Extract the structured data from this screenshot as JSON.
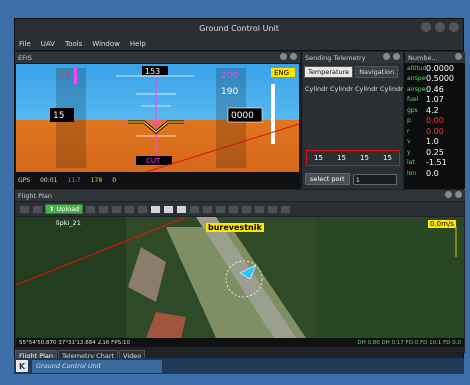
{
  "window": {
    "title": "Ground Control Unit"
  },
  "menu": [
    "File",
    "UAV",
    "Tools",
    "Window",
    "Help"
  ],
  "efis": {
    "panel_title": "EFIS",
    "speed": "23",
    "speed_lower": "15",
    "altitude": "200",
    "altitude_lower": "190",
    "heading": "153",
    "altitude_box": "0000",
    "eng_label": "ENG",
    "cut_label": "CUT",
    "bottom_left": "GPS",
    "bottom_time": "00:01",
    "bottom_val1": "11.7",
    "bottom_val2": "178",
    "bottom_val3": "0"
  },
  "telemetry": {
    "panel_title": "Sending Telemetry",
    "tabs": [
      "Temperature",
      "Navigation"
    ],
    "cylinder_labels": "Cylindr Cylindr Cylindr Cylindr",
    "values": [
      "15",
      "15",
      "15",
      "15"
    ],
    "port_button": "select port",
    "port_value": "1"
  },
  "numbers": {
    "panel_title": "Numbe...",
    "rows": [
      {
        "k": "altitude",
        "v": "0.0000"
      },
      {
        "k": "airspeed",
        "v": "0.5000"
      },
      {
        "k": "airspeed",
        "v": "0.46"
      },
      {
        "k": "fuel",
        "v": "1.07"
      },
      {
        "k": "gps",
        "v": "4.2"
      },
      {
        "k": "p",
        "v": "0.00"
      },
      {
        "k": "r",
        "v": "0.00"
      },
      {
        "k": "v",
        "v": "1.0"
      },
      {
        "k": "y",
        "v": "0.25"
      },
      {
        "k": "lat",
        "v": "-1.51"
      },
      {
        "k": "lon",
        "v": "0.0"
      }
    ]
  },
  "flight_plan": {
    "panel_title": "Flight Plan",
    "upload_label": "Upload",
    "waypoint_label": "lipki_21",
    "place_label": "burevestnik",
    "wind_label": "0.0m/s",
    "status_left": "55°54'50.870 37°31'12.884 ∠16 FPS:10",
    "status_right": "DH 0.80  DH 0.17  FD 0  FD 10.1  FD 0.0"
  },
  "bottom_tabs": [
    "Flight Plan",
    "Telemetry Chart",
    "Video"
  ],
  "taskbar": {
    "task_label": "Ground Control Unit"
  }
}
